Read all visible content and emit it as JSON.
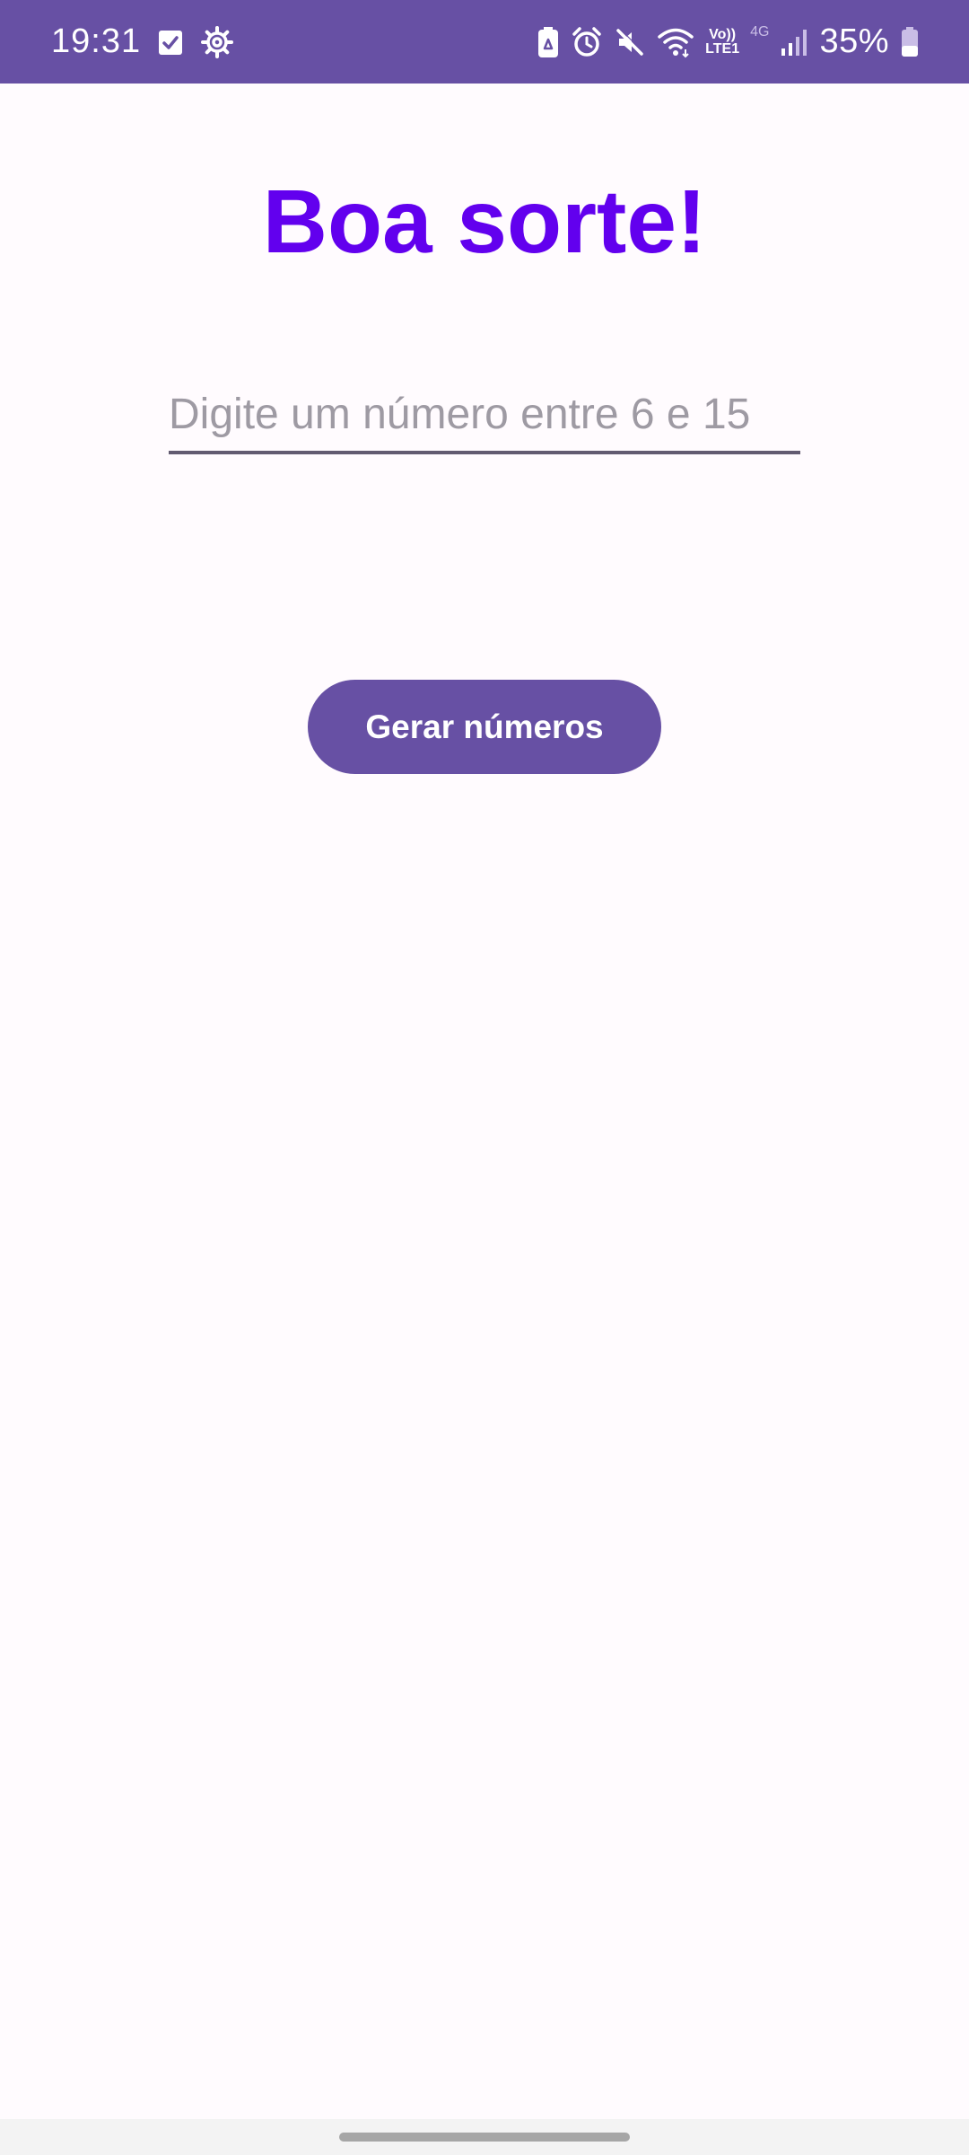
{
  "status_bar": {
    "time": "19:31",
    "battery_percent": "35%",
    "volte_label_top": "Vo))",
    "volte_label_bottom": "LTE1",
    "network_type": "4G",
    "background_color": "#6750a4",
    "left_icons": [
      "checkbox-notification-icon",
      "settings-gear-icon"
    ],
    "right_icons": [
      "battery-saver-icon",
      "alarm-icon",
      "mute-icon",
      "wifi-icon",
      "volte-icon",
      "signal-icon",
      "battery-icon"
    ]
  },
  "main": {
    "title": "Boa sorte!",
    "title_color": "#6200ee",
    "input": {
      "placeholder": "Digite um número entre 6 e 15",
      "value": ""
    },
    "button_label": "Gerar números",
    "accent_color": "#6750a4"
  }
}
